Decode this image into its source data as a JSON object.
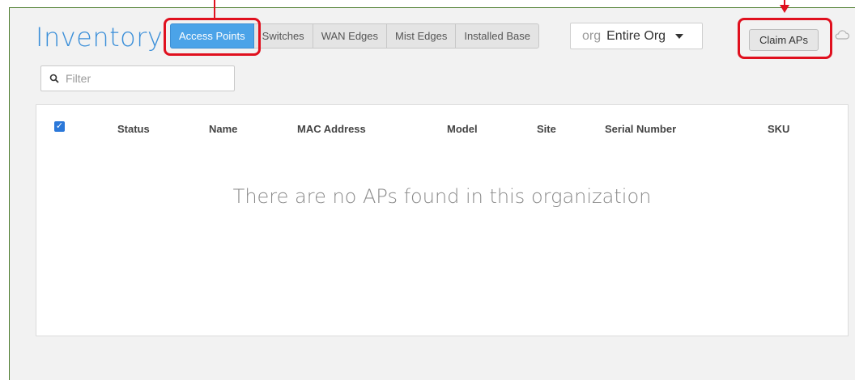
{
  "header": {
    "title": "Inventory"
  },
  "tabs": [
    {
      "label": "Access Points",
      "active": true
    },
    {
      "label": "Switches",
      "active": false
    },
    {
      "label": "WAN Edges",
      "active": false
    },
    {
      "label": "Mist Edges",
      "active": false
    },
    {
      "label": "Installed Base",
      "active": false
    }
  ],
  "org_selector": {
    "prefix": "org",
    "value": "Entire Org"
  },
  "claim_button": {
    "label": "Claim APs"
  },
  "filter": {
    "placeholder": "Filter",
    "value": ""
  },
  "table": {
    "select_all_checked": true,
    "columns": [
      "Status",
      "Name",
      "MAC Address",
      "Model",
      "Site",
      "Serial Number",
      "SKU"
    ],
    "rows": [],
    "empty_message": "There are no APs found in this organization"
  },
  "colors": {
    "accent": "#4ba3e8",
    "title": "#3b8fd9",
    "highlight": "#e0101e",
    "frame": "#4a7a2a"
  },
  "icons": {
    "search": "search-icon",
    "dropdown": "caret-down-icon",
    "cloud": "cloud-icon",
    "checkbox": "checkbox-checked-icon"
  }
}
